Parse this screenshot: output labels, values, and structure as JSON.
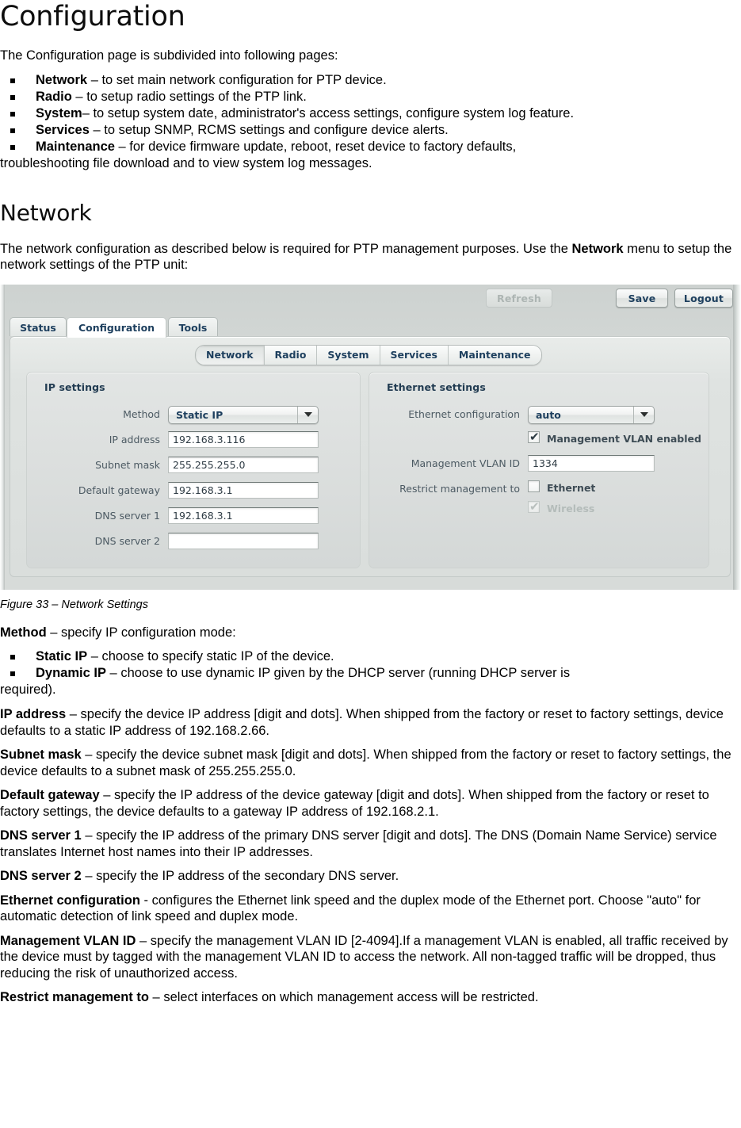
{
  "document": {
    "h1": "Configuration",
    "intro": "The Configuration page is subdivided into following pages:",
    "page_bullets": [
      {
        "bold": "Network",
        "rest": " – to set main network configuration for PTP device."
      },
      {
        "bold": "Radio",
        "rest": " – to setup radio settings of the PTP link."
      },
      {
        "bold": "System",
        "rest": "– to setup system date, administrator's access settings, configure system log feature."
      },
      {
        "bold": "Services",
        "rest": " – to setup SNMP, RCMS settings and configure device alerts."
      },
      {
        "bold": "Maintenance",
        "rest": " – for device firmware update, reboot, reset device to factory defaults,"
      }
    ],
    "bullets_tail": "troubleshooting file download and to view system log messages.",
    "h2": "Network",
    "network_intro_1": "The network configuration as described below is required for PTP management purposes. Use the ",
    "network_intro_bold": "Network",
    "network_intro_2": " menu to setup the network settings of the PTP unit:",
    "figure_caption": "Figure 33 – Network Settings",
    "method_heading_bold": "Method",
    "method_heading_rest": " – specify IP configuration mode:",
    "method_bullets": [
      {
        "bold": "Static IP",
        "rest": " – choose to specify static IP of the device."
      },
      {
        "bold": "Dynamic IP",
        "rest": " – choose to use dynamic IP given by the DHCP server (running DHCP server is"
      }
    ],
    "method_bullets_tail": "required).",
    "definitions": [
      {
        "bold": "IP address",
        "rest": " – specify the device IP address [digit and dots]. When shipped from the factory or reset to factory settings, device defaults to a static IP address of 192.168.2.66."
      },
      {
        "bold": "Subnet mask",
        "rest": " – specify the device subnet mask [digit and dots]. When shipped from the factory or reset to factory settings, the device defaults to a subnet mask of 255.255.255.0."
      },
      {
        "bold": "Default gateway",
        "rest": " – specify the IP address of the device gateway [digit and dots]. When shipped from the factory or reset to factory settings, the device defaults to a gateway IP address of 192.168.2.1."
      },
      {
        "bold": "DNS server 1",
        "rest": " – specify the IP address of the primary DNS server [digit and dots]. The DNS (Domain Name Service) service translates Internet host names into their IP addresses."
      },
      {
        "bold": "DNS server 2",
        "rest": " – specify the IP address of the secondary DNS server."
      },
      {
        "bold": "Ethernet configuration",
        "rest": " - configures the Ethernet link speed and the duplex mode of the Ethernet port. Choose \"auto\" for automatic detection of link speed and duplex mode."
      },
      {
        "bold": "Management VLAN ID",
        "rest": " – specify the management VLAN ID [2-4094].If a management VLAN is enabled, all traffic received by the device must by tagged with the management VLAN ID to access the network. All non-tagged traffic will be dropped, thus reducing the risk of unauthorized access."
      },
      {
        "bold": "Restrict management to",
        "rest": " – select interfaces on which management access will be restricted."
      }
    ]
  },
  "screenshot": {
    "actions": [
      {
        "id": "refresh",
        "label": "Refresh",
        "disabled": true
      },
      {
        "id": "save",
        "label": "Save",
        "disabled": false
      },
      {
        "id": "logout",
        "label": "Logout",
        "disabled": false
      }
    ],
    "main_tabs": [
      {
        "id": "status",
        "label": "Status",
        "active": false
      },
      {
        "id": "configuration",
        "label": "Configuration",
        "active": true
      },
      {
        "id": "tools",
        "label": "Tools",
        "active": false
      }
    ],
    "sub_tabs": [
      {
        "id": "network",
        "label": "Network",
        "active": true
      },
      {
        "id": "radio",
        "label": "Radio",
        "active": false
      },
      {
        "id": "system",
        "label": "System",
        "active": false
      },
      {
        "id": "services",
        "label": "Services",
        "active": false
      },
      {
        "id": "maintenance",
        "label": "Maintenance",
        "active": false
      }
    ],
    "ip_settings": {
      "title": "IP settings",
      "method_label": "Method",
      "method_value": "Static IP",
      "ip_address_label": "IP address",
      "ip_address_value": "192.168.3.116",
      "subnet_mask_label": "Subnet mask",
      "subnet_mask_value": "255.255.255.0",
      "default_gateway_label": "Default gateway",
      "default_gateway_value": "192.168.3.1",
      "dns1_label": "DNS server 1",
      "dns1_value": "192.168.3.1",
      "dns2_label": "DNS server 2",
      "dns2_value": ""
    },
    "ethernet_settings": {
      "title": "Ethernet settings",
      "eth_config_label": "Ethernet configuration",
      "eth_config_value": "auto",
      "mgmt_vlan_enabled_label": "Management VLAN enabled",
      "mgmt_vlan_enabled_checked": true,
      "mgmt_vlan_id_label": "Management VLAN ID",
      "mgmt_vlan_id_value": "1334",
      "restrict_label": "Restrict management to",
      "restrict_ethernet_label": "Ethernet",
      "restrict_ethernet_checked": false,
      "restrict_wireless_label": "Wireless",
      "restrict_wireless_checked": true,
      "restrict_wireless_disabled": true
    },
    "glyphs": {
      "check": "✔",
      "caret_down": "▼"
    }
  },
  "colors": {
    "accent_text": "#1d3f5e",
    "panel_bg": "#dcdfde",
    "chrome_bg": "#d3d8d6",
    "disabled_text": "#adb5b3"
  }
}
